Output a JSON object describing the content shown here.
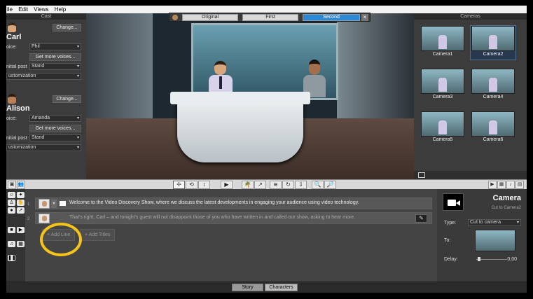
{
  "menu": [
    "ile",
    "Edit",
    "Views",
    "Help"
  ],
  "cast": {
    "header": "Cast",
    "characters": [
      {
        "name": "Carl",
        "change_label": "Change...",
        "voice_label": "oice:",
        "voice": "Phil",
        "more_voices": "Get more voices...",
        "pose_label": "nitial post",
        "pose": "Stand",
        "customization": "ustomization"
      },
      {
        "name": "Alison",
        "change_label": "Change...",
        "voice_label": "oice:",
        "voice": "Amanda",
        "more_voices": "Get more voices...",
        "pose_label": "nitial post",
        "pose": "Stand",
        "customization": "ustomization"
      }
    ]
  },
  "view_toggle": {
    "options": [
      "Original",
      "First",
      "Second"
    ],
    "selected": "Second",
    "close": "×"
  },
  "cameras": {
    "header": "Cameras",
    "items": [
      "Camera1",
      "Camera2",
      "Camera3",
      "Camera4",
      "Camera5",
      "Camera6"
    ],
    "selected": "Camera2"
  },
  "toolbar": {
    "icons": [
      "pointer-icon",
      "rotate-icon",
      "updown-icon",
      "play-icon",
      "palm-icon",
      "wave-icon",
      "wifi-icon",
      "refresh-icon",
      "down-icon",
      "zoom-in-icon",
      "zoom-out-icon"
    ],
    "glyphs": [
      "✢",
      "⟲",
      "↕",
      "▶",
      "🌴",
      "↗",
      "≋",
      "↻",
      "⇩",
      "🔍",
      "🔎"
    ]
  },
  "story": {
    "lines": [
      {
        "num": "1",
        "text": "Welcome to the Video Discovery Show, where we discuss the latest developments in engaging your audience using video technology."
      },
      {
        "num": "2",
        "text": "That's right, Carl – and tonight's guest will not disappoint those of you who have written in and called our show, asking to hear more."
      }
    ],
    "add_line": "+ Add Line",
    "add_titles": "+ Add Titles"
  },
  "properties": {
    "title": "Camera",
    "subtitle": "Cut to Camera2",
    "type_label": "Type:",
    "type_value": "Cut to camera",
    "to_label": "To:",
    "delay_label": "Delay:",
    "delay_value": "0,00"
  },
  "bottom_tabs": {
    "story": "Story",
    "characters": "Characters",
    "selected": "Story"
  },
  "colors": {
    "accent": "#2b8ad8",
    "highlight_ring": "#f5c41a"
  }
}
